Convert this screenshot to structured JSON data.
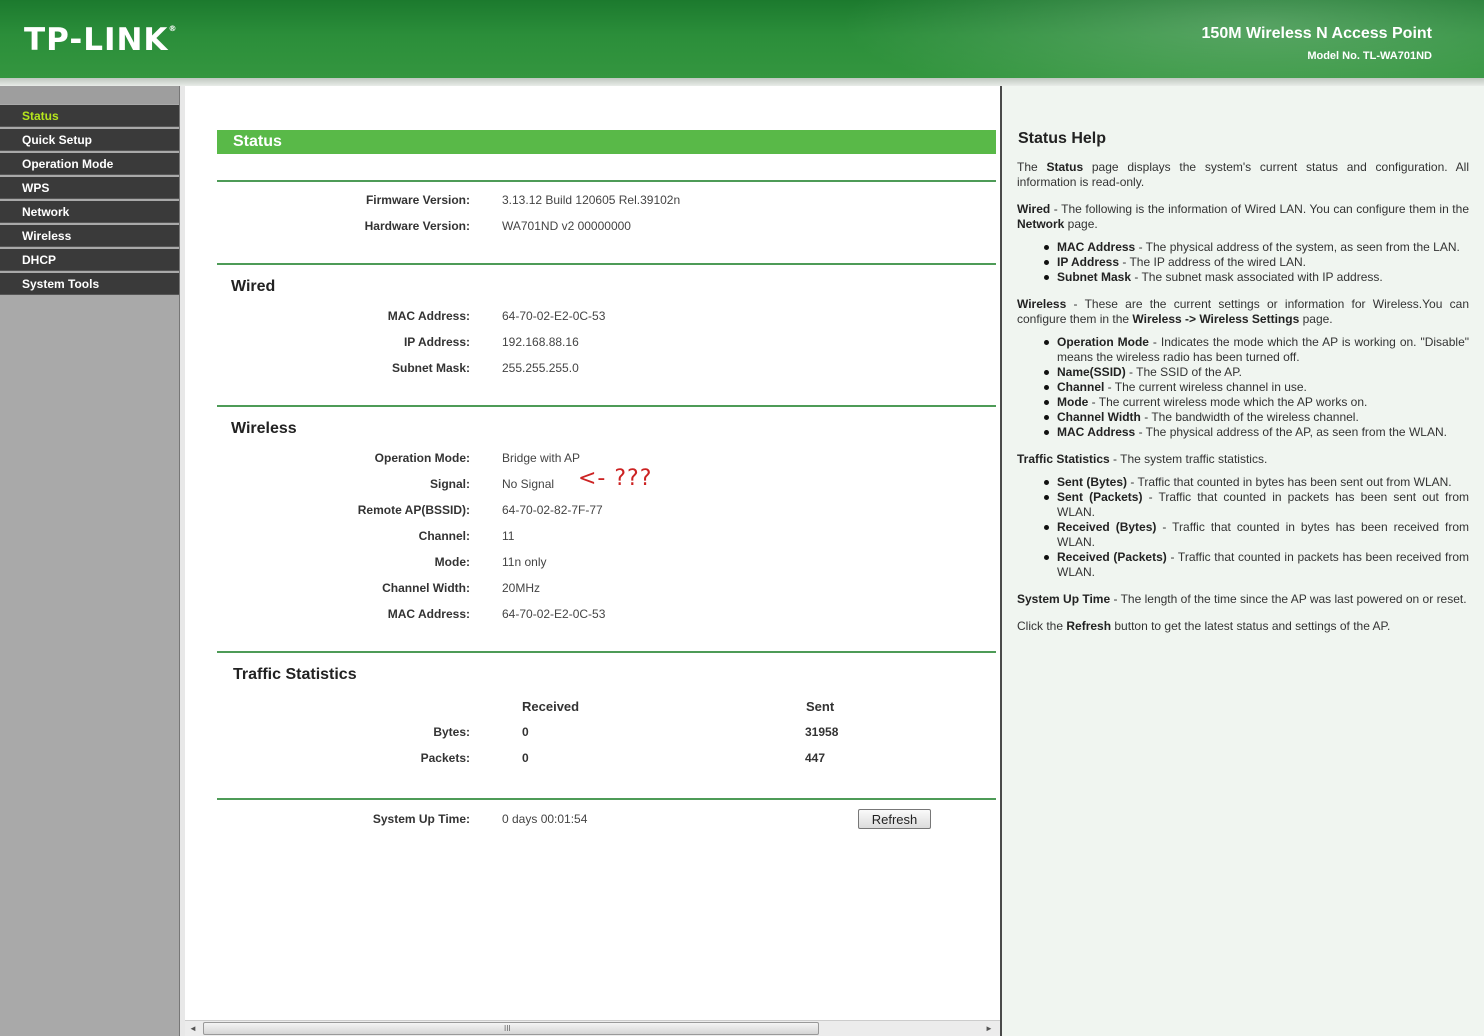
{
  "header": {
    "logo": "TP-LINK",
    "product_name": "150M Wireless N Access Point",
    "model_no": "Model No. TL-WA701ND"
  },
  "sidebar": {
    "items": [
      {
        "label": "Status",
        "active": true
      },
      {
        "label": "Quick Setup"
      },
      {
        "label": "Operation Mode"
      },
      {
        "label": "WPS"
      },
      {
        "label": "Network"
      },
      {
        "label": "Wireless"
      },
      {
        "label": "DHCP"
      },
      {
        "label": "System Tools"
      }
    ]
  },
  "status": {
    "title": "Status",
    "firmware_label": "Firmware Version:",
    "firmware_value": "3.13.12 Build 120605 Rel.39102n",
    "hardware_label": "Hardware Version:",
    "hardware_value": "WA701ND v2 00000000",
    "wired": {
      "title": "Wired",
      "mac_label": "MAC Address:",
      "mac_value": "64-70-02-E2-0C-53",
      "ip_label": "IP Address:",
      "ip_value": "192.168.88.16",
      "mask_label": "Subnet Mask:",
      "mask_value": "255.255.255.0"
    },
    "wireless": {
      "title": "Wireless",
      "opmode_label": "Operation Mode:",
      "opmode_value": "Bridge with AP",
      "signal_label": "Signal:",
      "signal_value": "No Signal",
      "signal_annotation": "<-  ???",
      "remote_label": "Remote AP(BSSID):",
      "remote_value": "64-70-02-82-7F-77",
      "channel_label": "Channel:",
      "channel_value": "11",
      "mode_label": "Mode:",
      "mode_value": "11n only",
      "width_label": "Channel Width:",
      "width_value": "20MHz",
      "mac_label": "MAC Address:",
      "mac_value": "64-70-02-E2-0C-53"
    },
    "traffic": {
      "title": "Traffic Statistics",
      "col_received": "Received",
      "col_sent": "Sent",
      "bytes_label": "Bytes:",
      "bytes_received": "0",
      "bytes_sent": "31958",
      "packets_label": "Packets:",
      "packets_received": "0",
      "packets_sent": "447"
    },
    "uptime_label": "System Up Time:",
    "uptime_value": "0 days 00:01:54",
    "refresh_label": "Refresh"
  },
  "scrollbar": {
    "left_arrow": "◄",
    "right_arrow": "►",
    "grip": "III"
  },
  "help": {
    "title": "Status Help",
    "p1_pre": "The ",
    "p1_bold": "Status",
    "p1_post": " page displays the system's current status and configuration. All information is read-only.",
    "p2_bold": "Wired",
    "p2_mid": " - The following is the information of Wired LAN. You can configure them in the ",
    "p2_bold2": "Network",
    "p2_post": " page.",
    "wired_items": [
      {
        "term": "MAC Address",
        "desc": " - The physical address of the system, as seen from the LAN."
      },
      {
        "term": "IP Address",
        "desc": " - The IP address of the wired LAN."
      },
      {
        "term": "Subnet Mask",
        "desc": " - The subnet mask associated with IP address."
      }
    ],
    "p3_bold": "Wireless",
    "p3_mid": " - These are the current settings or information for Wireless.You can configure them in the ",
    "p3_bold2": "Wireless -> Wireless Settings",
    "p3_post": " page.",
    "wireless_items": [
      {
        "term": "Operation Mode",
        "desc": " - Indicates the mode which the AP is working on. \"Disable\" means the wireless radio has been turned off."
      },
      {
        "term": "Name(SSID)",
        "desc": " - The SSID of the AP."
      },
      {
        "term": "Channel",
        "desc": " - The current wireless channel in use."
      },
      {
        "term": "Mode",
        "desc": " - The current wireless mode which the AP works on."
      },
      {
        "term": "Channel Width",
        "desc": " - The bandwidth of the wireless channel."
      },
      {
        "term": "MAC Address",
        "desc": " - The physical address of the AP, as seen from the WLAN."
      }
    ],
    "p4_bold": "Traffic Statistics",
    "p4_post": " - The system traffic statistics.",
    "traffic_items": [
      {
        "term": "Sent (Bytes)",
        "desc": " - Traffic that counted in bytes has been sent out from WLAN."
      },
      {
        "term": "Sent (Packets)",
        "desc": " - Traffic that counted in packets has been sent out from WLAN."
      },
      {
        "term": "Received (Bytes)",
        "desc": " - Traffic that counted in bytes has been received from WLAN."
      },
      {
        "term": "Received (Packets)",
        "desc": " - Traffic that counted in packets has been received from WLAN."
      }
    ],
    "p5_bold": "System Up Time",
    "p5_post": " - The length of the time since the AP was last powered on or reset.",
    "p6_pre": "Click the ",
    "p6_bold": "Refresh",
    "p6_post": " button to get the latest status and settings of the AP."
  }
}
